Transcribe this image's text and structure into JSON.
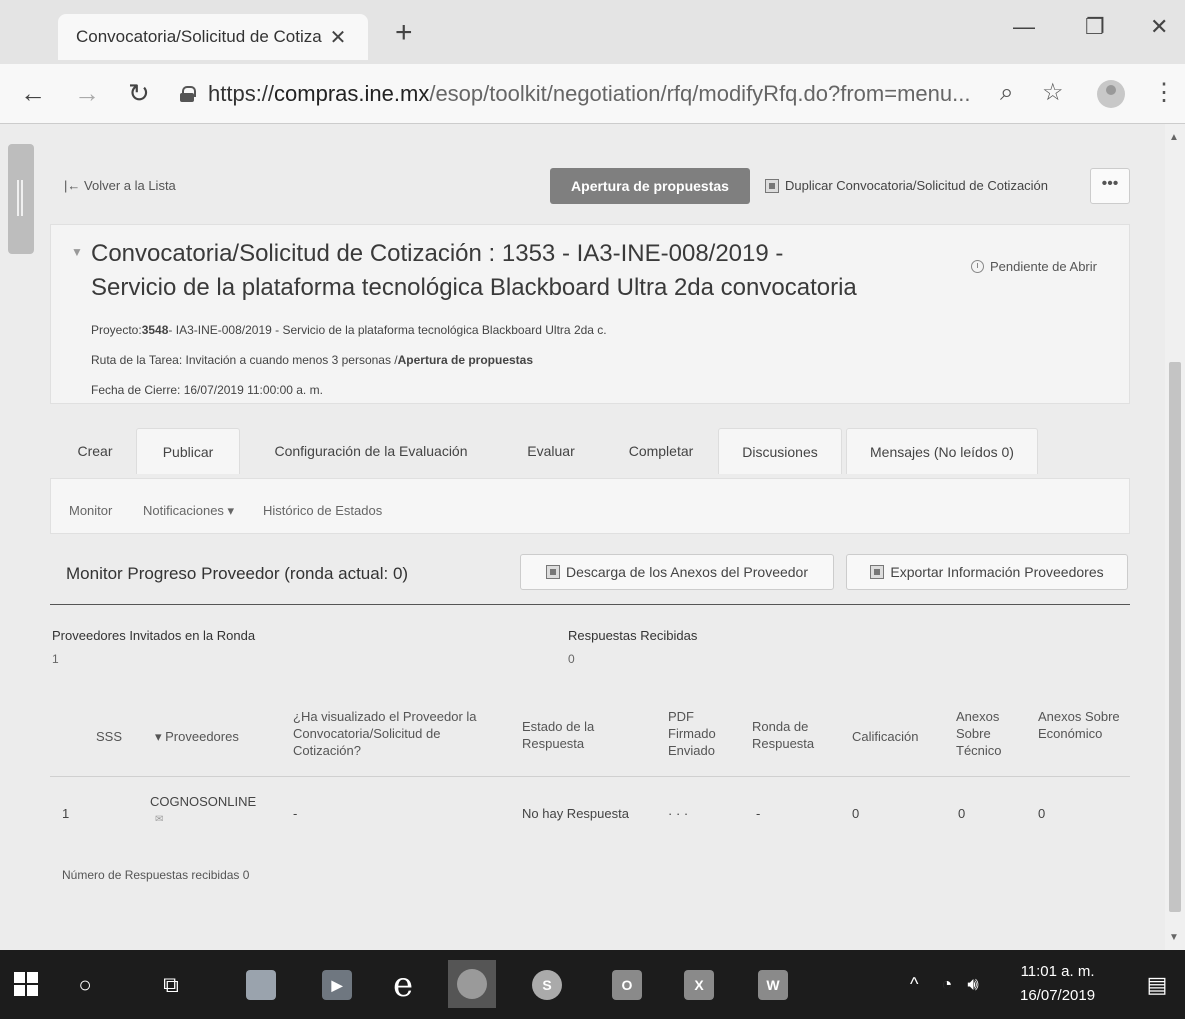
{
  "browser": {
    "tab_title": "Convocatoria/Solicitud de Cotiza",
    "tab_close": "✕",
    "new_tab": "+",
    "url_scheme": "https://",
    "url_host": "compras.ine.mx",
    "url_path": "/esop/toolkit/negotiation/rfq/modifyRfq.do?from=menu..."
  },
  "toolbar": {
    "back_label": "Volver a la Lista",
    "primary_button": "Apertura de propuestas",
    "duplicate_label": "Duplicar Convocatoria/Solicitud de Cotización",
    "more_label": "•••"
  },
  "header": {
    "title_line1": "Convocatoria/Solicitud de Cotización : 1353 - IA3-INE-008/2019 -",
    "title_line2": "Servicio de la plataforma tecnológica Blackboard Ultra 2da convocatoria",
    "status": "Pendiente de Abrir",
    "project_label": "Proyecto:",
    "project_code": "3548",
    "project_rest": "- IA3-INE-008/2019 - Servicio de la plataforma tecnológica Blackboard Ultra 2da c.",
    "route_label": "Ruta de la Tarea: Invitación a cuando menos 3 personas /",
    "route_strong": "Apertura de propuestas",
    "close_date": "Fecha de Cierre: 16/07/2019 11:00:00 a. m."
  },
  "tabs": [
    {
      "label": "Crear"
    },
    {
      "label": "Publicar"
    },
    {
      "label": "Configuración de la Evaluación"
    },
    {
      "label": "Evaluar"
    },
    {
      "label": "Completar"
    },
    {
      "label": "Discusiones"
    },
    {
      "label": "Mensajes (No leídos 0)"
    }
  ],
  "subnav": [
    {
      "label": "Monitor"
    },
    {
      "label": "Notificaciones ▾"
    },
    {
      "label": "Histórico de Estados"
    }
  ],
  "monitor": {
    "title": "Monitor Progreso Proveedor (ronda actual: 0)",
    "download_button": "Descarga de los Anexos del Proveedor",
    "export_button": "Exportar Información Proveedores",
    "invited_label": "Proveedores Invitados en la Ronda",
    "invited_value": "1",
    "received_label": "Respuestas Recibidas",
    "received_value": "0"
  },
  "table": {
    "headers": [
      "SSS",
      "▾ Proveedores",
      "¿Ha visualizado el Proveedor la Convocatoria/Solicitud de Cotización?",
      "Estado de la Respuesta",
      "PDF Firmado Enviado",
      "Ronda de Respuesta",
      "Calificación",
      "Anexos Sobre Técnico",
      "Anexos Sobre Económico"
    ],
    "rows": [
      [
        "1",
        "COGNOSONLINE",
        "-",
        "No hay Respuesta",
        "· · ·",
        "-",
        "0",
        "0",
        "0"
      ]
    ],
    "footer": "Número de Respuestas recibidas 0"
  },
  "taskbar": {
    "time": "11:01 a. m.",
    "date": "16/07/2019",
    "apps": [
      "O",
      "X",
      "W"
    ]
  }
}
